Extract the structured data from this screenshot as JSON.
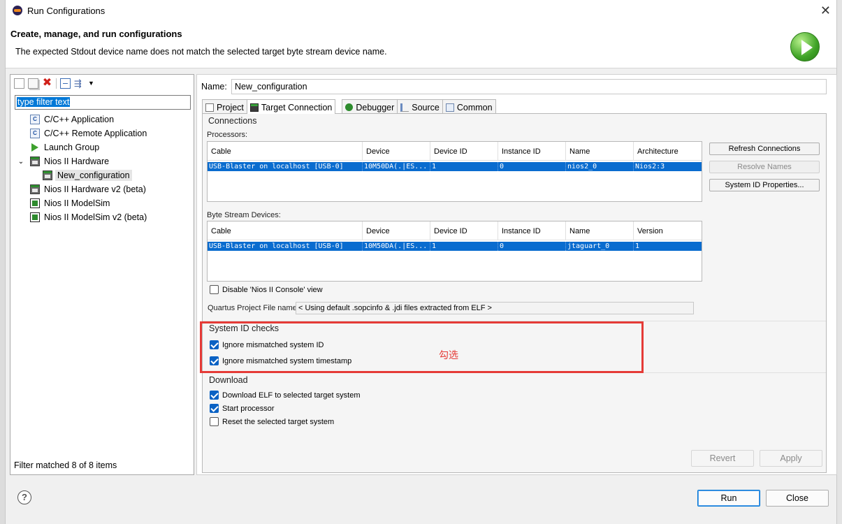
{
  "window": {
    "title": "Run Configurations",
    "close_glyph": "✕"
  },
  "header": {
    "title": "Create, manage, and run configurations",
    "message": "The expected Stdout device name does not match the selected target byte stream device name.",
    "icon": "run-icon"
  },
  "left": {
    "toolbar": {
      "new_icon": "new-configuration-icon",
      "duplicate_icon": "duplicate-icon",
      "delete_glyph": "✖",
      "collapse_icon": "collapse-all-icon",
      "filter_glyph": "⇶",
      "dropdown_glyph": "▼"
    },
    "filter_text": "type filter text",
    "tree": [
      {
        "label": "C/C++ Application",
        "icon": "c-app-icon",
        "glyph": "C"
      },
      {
        "label": "C/C++ Remote Application",
        "icon": "c-app-icon",
        "glyph": "C"
      },
      {
        "label": "Launch Group",
        "icon": "launch-group-icon"
      },
      {
        "label": "Nios II Hardware",
        "icon": "nios-hardware-icon",
        "expanded": true,
        "twisty": "⌄"
      },
      {
        "label": "New_configuration",
        "icon": "nios-hardware-icon",
        "selected": true
      },
      {
        "label": "Nios II Hardware v2 (beta)",
        "icon": "nios-hardware-icon"
      },
      {
        "label": "Nios II ModelSim",
        "icon": "modelsim-icon"
      },
      {
        "label": "Nios II ModelSim v2 (beta)",
        "icon": "modelsim-icon"
      }
    ],
    "footer": "Filter matched 8 of 8 items"
  },
  "right": {
    "name_label": "Name:",
    "name_value": "New_configuration",
    "tabs": [
      "Project",
      "Target Connection",
      "Debugger",
      "Source",
      "Common"
    ],
    "active_tab": "Target Connection",
    "connections": {
      "title": "Connections",
      "processors_label": "Processors:",
      "processor_headers": [
        "Cable",
        "Device",
        "Device ID",
        "Instance ID",
        "Name",
        "Architecture"
      ],
      "processor_row": [
        "USB-Blaster on localhost [USB-0]",
        "10M50DA(.|ES...",
        "1",
        "0",
        "nios2_0",
        "Nios2:3"
      ],
      "byte_stream_label": "Byte Stream Devices:",
      "byte_headers": [
        "Cable",
        "Device",
        "Device ID",
        "Instance ID",
        "Name",
        "Version"
      ],
      "byte_row": [
        "USB-Blaster on localhost [USB-0]",
        "10M50DA(.|ES...",
        "1",
        "0",
        "jtaguart_0",
        "1"
      ],
      "refresh_button": "Refresh Connections",
      "resolve_button": "Resolve Names",
      "sysid_button": "System ID Properties...",
      "disable_console": {
        "label": "Disable 'Nios II Console' view",
        "checked": false
      },
      "quartus_label": "Quartus Project File name:",
      "quartus_value": "< Using default .sopcinfo & .jdi files extracted from ELF >"
    },
    "system_id": {
      "title": "System ID checks",
      "ignore_id": {
        "label": "Ignore mismatched system ID",
        "checked": true
      },
      "ignore_timestamp": {
        "label": "Ignore mismatched system timestamp",
        "checked": true
      }
    },
    "download": {
      "title": "Download",
      "download_elf": {
        "label": "Download ELF to selected target system",
        "checked": true
      },
      "start_processor": {
        "label": "Start processor",
        "checked": true
      },
      "reset_target": {
        "label": "Reset the selected target system",
        "checked": false
      }
    },
    "revert_button": "Revert",
    "apply_button": "Apply"
  },
  "annotation": {
    "text": "勾选",
    "color": "#e53b37"
  },
  "footer": {
    "run_button": "Run",
    "close_button": "Close",
    "help_glyph": "?"
  },
  "colors": {
    "selection": "#0a6ccf",
    "checkbox": "#0a62c4",
    "highlight": "#e53b37"
  }
}
